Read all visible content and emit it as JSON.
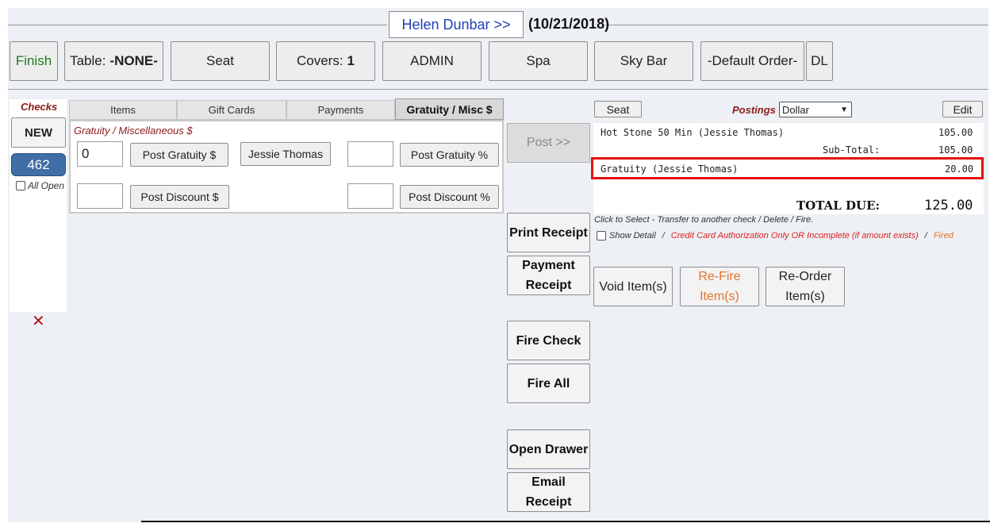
{
  "header": {
    "guest_name": "Helen Dunbar >>",
    "date": "(10/21/2018)"
  },
  "toolbar": {
    "finish": "Finish",
    "table_label": "Table:",
    "table_value": "-NONE-",
    "seat": "Seat",
    "covers_label": "Covers:",
    "covers_value": "1",
    "admin": "ADMIN",
    "spa": "Spa",
    "sky_bar": "Sky Bar",
    "default_order": "-Default Order-",
    "dl": "DL"
  },
  "checks": {
    "title": "Checks",
    "new_label": "NEW",
    "items": [
      "462"
    ],
    "all_open_label": "All Open",
    "all_open_checked": false
  },
  "tabs": {
    "items": [
      "Items",
      "Gift Cards",
      "Payments",
      "Gratuity / Misc $"
    ],
    "active": "Gratuity / Misc $"
  },
  "gratuity": {
    "section_title": "Gratuity / Miscellaneous $",
    "amount_value": "0",
    "post_gratuity_dollar": "Post Gratuity $",
    "staff_button": "Jessie Thomas",
    "percent_value": "",
    "post_gratuity_percent": "Post Gratuity %",
    "discount_amount_value": "",
    "post_discount_dollar": "Post Discount $",
    "discount_percent_value": "",
    "post_discount_percent": "Post Discount %"
  },
  "actions": {
    "post": "Post >>",
    "print_receipt": "Print Receipt",
    "payment_receipt": "Payment Receipt",
    "fire_check": "Fire Check",
    "fire_all": "Fire All",
    "open_drawer": "Open Drawer",
    "email_receipt": "Email Receipt"
  },
  "order": {
    "seat_button": "Seat",
    "postings_label": "Postings",
    "postings_selected": "Dollar",
    "edit_button": "Edit",
    "lines": [
      {
        "desc": "Hot Stone 50 Min (Jessie Thomas)",
        "amount": "105.00"
      }
    ],
    "subtotal_label": "Sub-Total:",
    "subtotal_value": "105.00",
    "gratuity_line": {
      "desc": "Gratuity (Jessie Thomas)",
      "amount": "20.00"
    },
    "total_label": "TOTAL DUE:",
    "total_value": "125.00",
    "hint": "Click to Select - Transfer to another check / Delete / Fire.",
    "show_detail_label": "Show Detail",
    "show_detail_checked": false,
    "slash": "/",
    "cc_note": "Credit Card Authorization Only OR Incomplete (if amount exists)",
    "fired_label": "Fired"
  },
  "item_actions": {
    "void": "Void Item(s)",
    "refire": "Re-Fire Item(s)",
    "reorder": "Re-Order Item(s)"
  },
  "colors": {
    "accent_red": "#e41010",
    "check_blue": "#3f6fa6",
    "label_maroon": "#8b1a1a",
    "finish_green": "#1f7a1f",
    "refire_orange": "#e8722a",
    "guest_blue": "#1f3fb8"
  },
  "icons": {
    "delete": "close-icon"
  }
}
